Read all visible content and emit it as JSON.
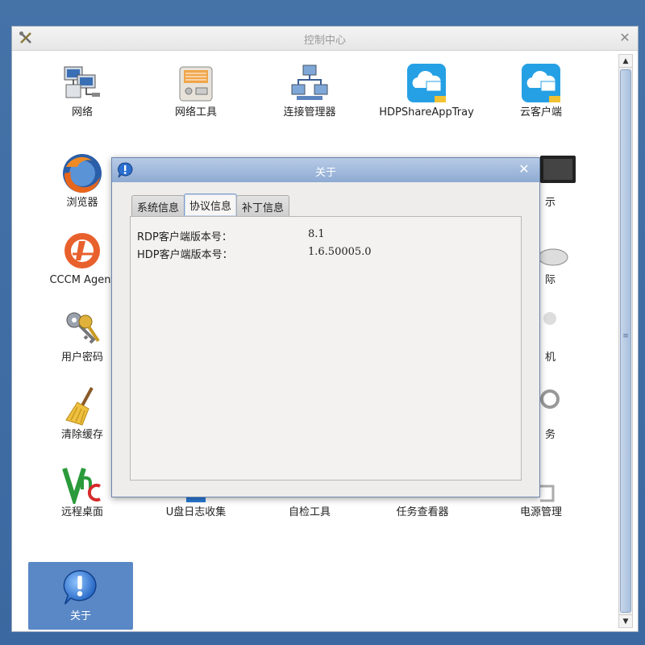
{
  "window": {
    "title": "控制中心",
    "close_glyph": "✕"
  },
  "launchers": [
    {
      "id": "network",
      "label": "网络",
      "icon": "network-icon"
    },
    {
      "id": "network-tools",
      "label": "网络工具",
      "icon": "network-tools-icon"
    },
    {
      "id": "connection-manager",
      "label": "连接管理器",
      "icon": "connection-manager-icon"
    },
    {
      "id": "hdp-share",
      "label": "HDPShareAppTray",
      "icon": "cloud-app-icon"
    },
    {
      "id": "cloud-client",
      "label": "云客户端",
      "icon": "cloud-client-icon"
    },
    {
      "id": "browser",
      "label": "浏览器",
      "icon": "firefox-icon"
    },
    {
      "id": "cccm",
      "label": "CCCM Agent",
      "icon": "cccm-icon"
    },
    {
      "id": "user-password",
      "label": "用户密码",
      "icon": "keys-icon"
    },
    {
      "id": "clear-cache",
      "label": "清除缓存",
      "icon": "broom-icon"
    },
    {
      "id": "remote-desktop",
      "label": "远程桌面",
      "icon": "vnc-icon"
    },
    {
      "id": "usb-log",
      "label": "U盘日志收集",
      "icon": "usb-log-icon"
    },
    {
      "id": "self-check",
      "label": "自检工具",
      "icon": "self-check-icon"
    },
    {
      "id": "task-viewer",
      "label": "任务查看器",
      "icon": "task-viewer-icon"
    },
    {
      "id": "power",
      "label": "电源管理",
      "icon": "power-icon"
    },
    {
      "id": "about",
      "label": "关于",
      "icon": "info-icon"
    }
  ],
  "partial_labels": {
    "r2": "示",
    "r3": "际",
    "r4": "机",
    "r5": "务"
  },
  "dialog": {
    "title": "关于",
    "close_glyph": "✕",
    "tabs": [
      "系统信息",
      "协议信息",
      "补丁信息"
    ],
    "active_tab": "协议信息",
    "rows": [
      {
        "label": "RDP客户端版本号：",
        "value": "8.1"
      },
      {
        "label": "HDP客户端版本号：",
        "value": "1.6.50005.0"
      }
    ]
  },
  "scrollbar": {
    "up": "▲",
    "down": "▼",
    "grip": "≡"
  },
  "colors": {
    "desktop": "#3a6ea5",
    "selection": "#5a88c6",
    "dialog_title": "#8eaad2"
  }
}
